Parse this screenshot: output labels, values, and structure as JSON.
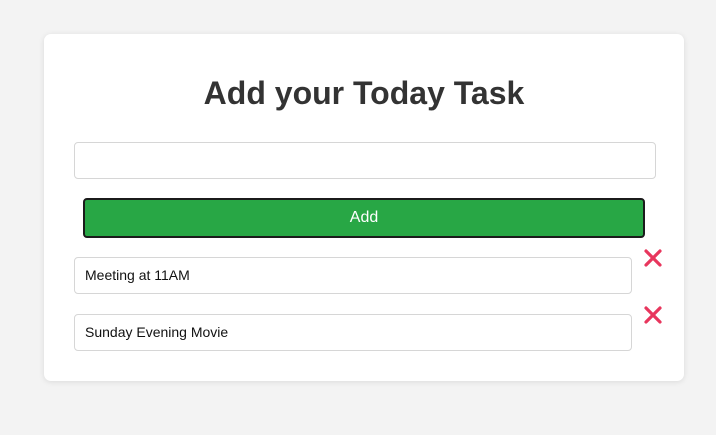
{
  "header": {
    "title": "Add your Today Task"
  },
  "new_task": {
    "value": "",
    "placeholder": ""
  },
  "add_button": {
    "label": "Add",
    "color": "#28a745"
  },
  "tasks": [
    {
      "text": "Meeting at 11AM"
    },
    {
      "text": "Sunday Evening Movie"
    }
  ],
  "delete_icon": {
    "icon": "close-icon",
    "color": "#e8365d"
  }
}
